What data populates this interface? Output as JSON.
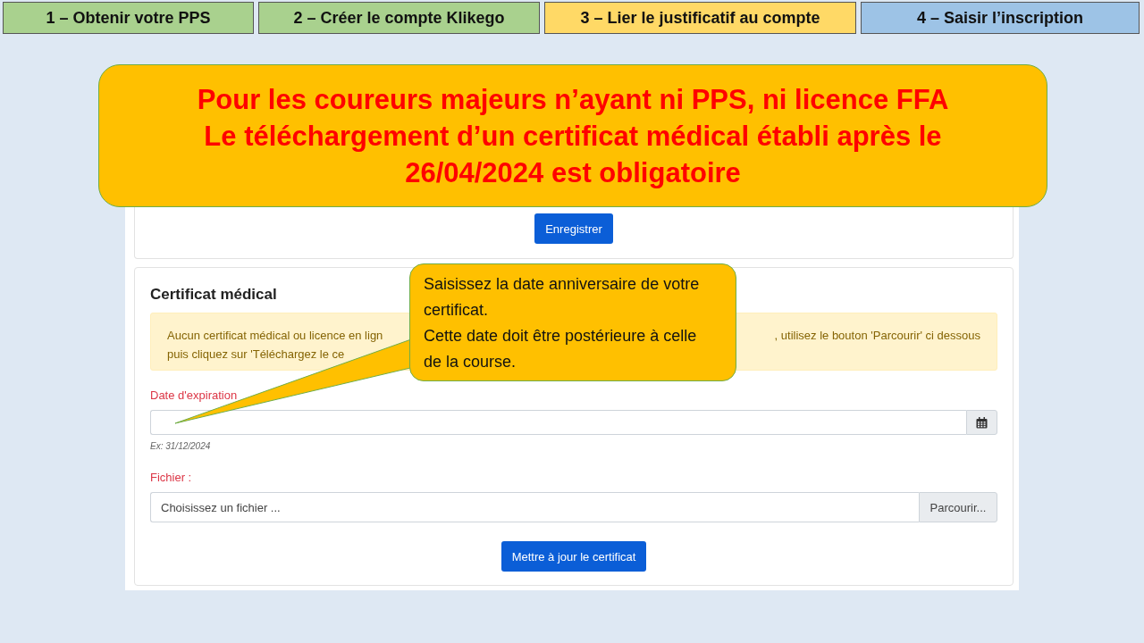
{
  "steps": [
    {
      "label": "1 – Obtenir votre PPS",
      "color": "#a9d18e"
    },
    {
      "label": "2 – Créer le compte Klikego",
      "color": "#a9d18e"
    },
    {
      "label": "3 – Lier le justificatif au compte",
      "color": "#ffd966"
    },
    {
      "label": "4 – Saisir l’inscription",
      "color": "#9dc3e6"
    }
  ],
  "banner": {
    "lines": [
      "Pour les coureurs majeurs n’ayant ni PPS, ni licence FFA",
      "Le téléchargement d’un certificat médical établi après le",
      "26/04/2024 est obligatoire"
    ]
  },
  "form": {
    "save_button": "Enregistrer",
    "section_title": "Certificat médical",
    "alert": {
      "line_1_left": "Aucun certificat médical ou licence en lign",
      "line_1_right": ", utilisez le bouton 'Parcourir' ci dessous",
      "line_2_left": "puis cliquez sur 'Téléchargez le ce"
    },
    "expiry_label": "Date d'expiration",
    "expiry_hint": "Ex: 31/12/2024",
    "file_label": "Fichier :",
    "file_placeholder": "Choisissez un fichier ...",
    "browse_button": "Parcourir...",
    "update_button": "Mettre à jour le certificat"
  },
  "callout": {
    "lines": [
      "Saisissez la date anniversaire de votre certificat.",
      "Cette date doit être postérieure à celle de la course."
    ]
  }
}
